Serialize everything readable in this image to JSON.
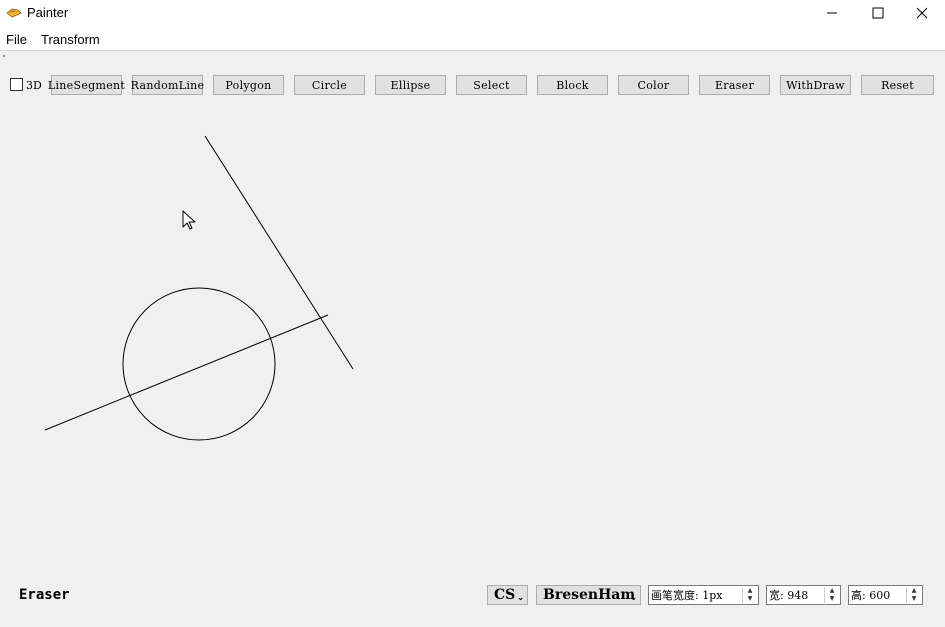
{
  "window": {
    "title": "Painter",
    "controls": {
      "minimize": "—",
      "maximize": "☐",
      "close": "✕"
    }
  },
  "menu": {
    "items": [
      "File",
      "Transform"
    ]
  },
  "toolbar": {
    "check_3d_label": "3D",
    "check_3d_checked": false,
    "buttons": [
      "LineSegment",
      "RandomLine",
      "Polygon",
      "Circle",
      "Ellipse",
      "Select",
      "Block",
      "Color",
      "Eraser",
      "WithDraw",
      "Reset"
    ]
  },
  "status": {
    "mode": "Eraser",
    "color_space": "CS",
    "algorithm": "BresenHam",
    "pen_width": "画笔宽度: 1px",
    "canvas_width": "宽: 948",
    "canvas_height": "高: 600"
  }
}
